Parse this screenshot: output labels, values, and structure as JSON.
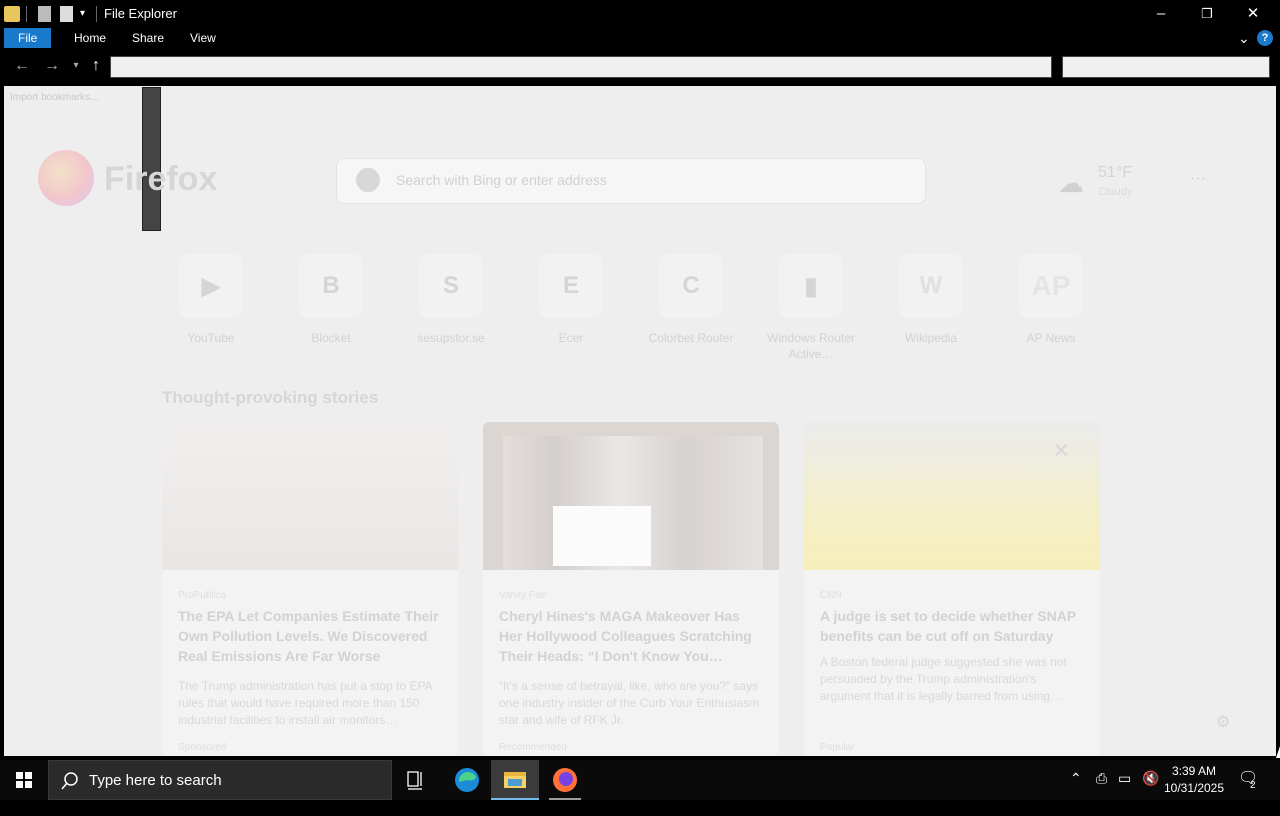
{
  "window": {
    "title": "File Explorer",
    "ribbon_tabs": [
      "File",
      "Home",
      "Share",
      "View"
    ],
    "controls": {
      "minimize": "–",
      "maximize": "❐",
      "close": "✕"
    },
    "help": "?"
  },
  "browser": {
    "tab_tooltip": "Import bookmarks…",
    "brand": "Firefox",
    "search_placeholder": "Search with Bing or enter address",
    "weather": {
      "temp": "51°F",
      "desc": "Cloudy"
    },
    "shortcuts": [
      {
        "label": "YouTube",
        "glyph": "▶"
      },
      {
        "label": "Blocket",
        "glyph": "B"
      },
      {
        "label": "sesupstor.se",
        "glyph": "S"
      },
      {
        "label": "Ecer",
        "glyph": "E"
      },
      {
        "label": "Colorbet Router",
        "glyph": "C"
      },
      {
        "label": "Windows Router Active…",
        "glyph": "▮"
      },
      {
        "label": "Wikipedia",
        "glyph": "W"
      },
      {
        "label": "AP News",
        "glyph": "AP"
      }
    ],
    "stories_heading": "Thought-provoking stories",
    "stories": [
      {
        "source": "ProPublica",
        "headline": "The EPA Let Companies Estimate Their Own Pollution Levels. We Discovered Real Emissions Are Far Worse",
        "excerpt": "The Trump administration has put a stop to EPA rules that would have required more than 150 industrial facilities to install air monitors…",
        "footer": "Sponsored"
      },
      {
        "source": "Vanity Fair",
        "headline": "Cheryl Hines's MAGA Makeover Has Her Hollywood Colleagues Scratching Their Heads: “I Don't Know You…",
        "excerpt": "“It's a sense of betrayal, like, who are you?” says one industry insider of the Curb Your Enthusiasm star and wife of RFK Jr.",
        "footer": "Recommended"
      },
      {
        "source": "CNN",
        "headline": "A judge is set to decide whether SNAP benefits can be cut off on Saturday",
        "excerpt": "A Boston federal judge suggested she was not persuaded by the Trump administration's argument that it is legally barred from using…",
        "footer": "Popular"
      }
    ]
  },
  "taskbar": {
    "search_placeholder": "Type here to search",
    "time": "3:39 AM",
    "date": "10/31/2025",
    "notification_count": "2"
  }
}
